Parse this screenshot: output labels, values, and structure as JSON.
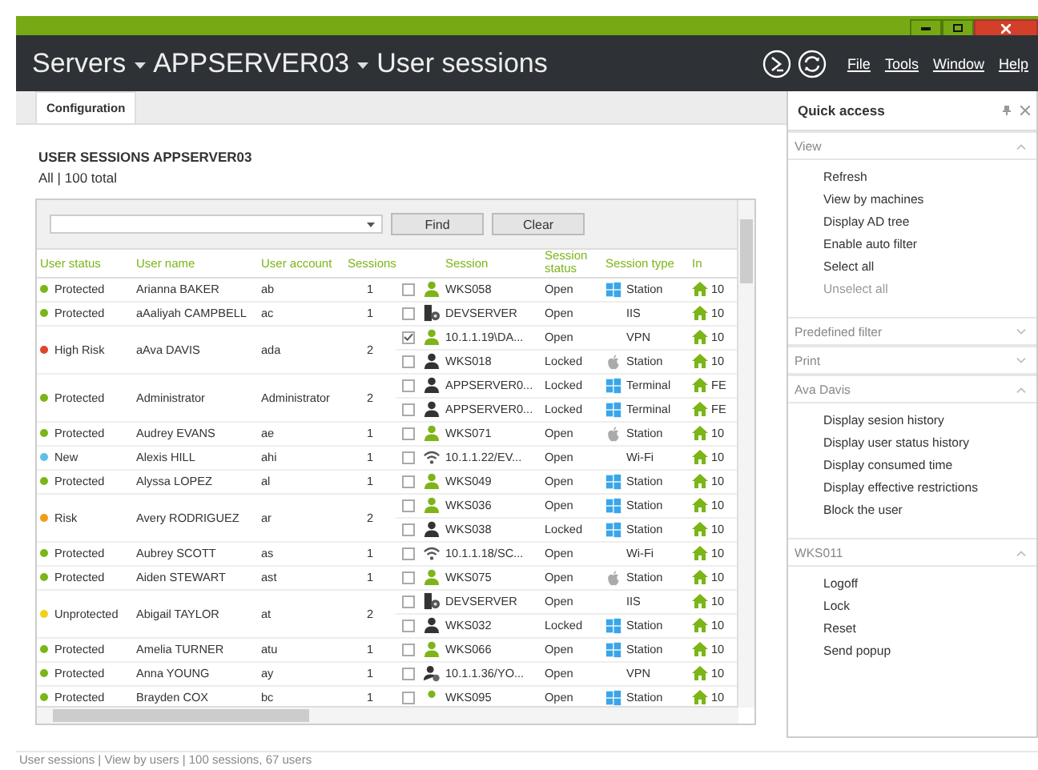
{
  "window": {
    "breadcrumb": [
      "Servers",
      "APPSERVER03",
      "User sessions"
    ],
    "menu": [
      "File",
      "Tools",
      "Window",
      "Help"
    ]
  },
  "tabs": [
    {
      "label": "Configuration",
      "selected": true
    }
  ],
  "heading": "USER SESSIONS APPSERVER03",
  "subheading": "All | 100 total",
  "filter": {
    "buttons": [
      "Find",
      "Clear"
    ]
  },
  "table": {
    "columns": [
      "User status",
      "User name",
      "User account",
      "Sessions",
      "Session",
      "Session status",
      "Session type",
      "In"
    ],
    "rows": [
      {
        "status": "Protected",
        "color": "#7cb518",
        "name": "Arianna BAKER",
        "account": "ab",
        "count": "1",
        "sessions": [
          {
            "checked": false,
            "kind": "user-open",
            "session": "WKS058",
            "state": "Open",
            "type": {
              "kind": "windows",
              "label": "Station"
            },
            "column_8": "10"
          }
        ]
      },
      {
        "status": "Protected",
        "color": "#7cb518",
        "name": "aAaliyah CAMPBELL",
        "account": "ac",
        "count": "1",
        "sessions": [
          {
            "checked": false,
            "kind": "server",
            "session": "DEVSERVER",
            "state": "Open",
            "type": {
              "kind": "plain",
              "label": "IIS"
            },
            "column_8": "10"
          }
        ]
      },
      {
        "status": "High Risk",
        "color": "#e0452b",
        "name": "aAva DAVIS",
        "account": "ada",
        "count": "2",
        "sessions": [
          {
            "checked": true,
            "kind": "user-open",
            "session": "10.1.1.19\\DA...",
            "state": "Open",
            "type": {
              "kind": "plain",
              "label": "VPN"
            },
            "column_8": "10"
          },
          {
            "checked": false,
            "kind": "user-locked",
            "session": "WKS018",
            "state": "Locked",
            "type": {
              "kind": "apple",
              "label": "Station"
            },
            "column_8": "10"
          }
        ]
      },
      {
        "status": "Protected",
        "color": "#7cb518",
        "name": "Administrator",
        "account": "Administrator",
        "count": "2",
        "sessions": [
          {
            "checked": false,
            "kind": "user-locked",
            "session": "APPSERVER0...",
            "state": "Locked",
            "type": {
              "kind": "windows",
              "label": "Terminal"
            },
            "column_8": "FE"
          },
          {
            "checked": false,
            "kind": "user-locked",
            "session": "APPSERVER0...",
            "state": "Locked",
            "type": {
              "kind": "windows",
              "label": "Terminal"
            },
            "column_8": "FE"
          }
        ]
      },
      {
        "status": "Protected",
        "color": "#7cb518",
        "name": "Audrey EVANS",
        "account": "ae",
        "count": "1",
        "sessions": [
          {
            "checked": false,
            "kind": "user-open",
            "session": "WKS071",
            "state": "Open",
            "type": {
              "kind": "apple",
              "label": "Station"
            },
            "column_8": "10"
          }
        ]
      },
      {
        "status": "New",
        "color": "#5bc0e8",
        "name": "Alexis HILL",
        "account": "ahi",
        "count": "1",
        "sessions": [
          {
            "checked": false,
            "kind": "wifi",
            "session": "10.1.1.22/EV...",
            "state": "Open",
            "type": {
              "kind": "plain",
              "label": "Wi-Fi"
            },
            "column_8": "10"
          }
        ]
      },
      {
        "status": "Protected",
        "color": "#7cb518",
        "name": "Alyssa LOPEZ",
        "account": "al",
        "count": "1",
        "sessions": [
          {
            "checked": false,
            "kind": "user-open",
            "session": "WKS049",
            "state": "Open",
            "type": {
              "kind": "windows",
              "label": "Station"
            },
            "column_8": "10"
          }
        ]
      },
      {
        "status": "Risk",
        "color": "#f39c12",
        "name": "Avery RODRIGUEZ",
        "account": "ar",
        "count": "2",
        "sessions": [
          {
            "checked": false,
            "kind": "user-open",
            "session": "WKS036",
            "state": "Open",
            "type": {
              "kind": "windows",
              "label": "Station"
            },
            "column_8": "10"
          },
          {
            "checked": false,
            "kind": "user-locked",
            "session": "WKS038",
            "state": "Locked",
            "type": {
              "kind": "windows",
              "label": "Station"
            },
            "column_8": "10"
          }
        ]
      },
      {
        "status": "Protected",
        "color": "#7cb518",
        "name": "Aubrey SCOTT",
        "account": "as",
        "count": "1",
        "sessions": [
          {
            "checked": false,
            "kind": "wifi",
            "session": "10.1.1.18/SC...",
            "state": "Open",
            "type": {
              "kind": "plain",
              "label": "Wi-Fi"
            },
            "column_8": "10"
          }
        ]
      },
      {
        "status": "Protected",
        "color": "#7cb518",
        "name": "Aiden STEWART",
        "account": "ast",
        "count": "1",
        "sessions": [
          {
            "checked": false,
            "kind": "user-open",
            "session": "WKS075",
            "state": "Open",
            "type": {
              "kind": "apple",
              "label": "Station"
            },
            "column_8": "10"
          }
        ]
      },
      {
        "status": "Unprotected",
        "color": "#f1d21b",
        "name": "Abigail TAYLOR",
        "account": "at",
        "count": "2",
        "sessions": [
          {
            "checked": false,
            "kind": "server",
            "session": "DEVSERVER",
            "state": "Open",
            "type": {
              "kind": "plain",
              "label": "IIS"
            },
            "column_8": "10"
          },
          {
            "checked": false,
            "kind": "user-locked",
            "session": "WKS032",
            "state": "Locked",
            "type": {
              "kind": "windows",
              "label": "Station"
            },
            "column_8": "10"
          }
        ]
      },
      {
        "status": "Protected",
        "color": "#7cb518",
        "name": "Amelia TURNER",
        "account": "atu",
        "count": "1",
        "sessions": [
          {
            "checked": false,
            "kind": "user-open",
            "session": "WKS066",
            "state": "Open",
            "type": {
              "kind": "windows",
              "label": "Station"
            },
            "column_8": "10"
          }
        ]
      },
      {
        "status": "Protected",
        "color": "#7cb518",
        "name": "Anna YOUNG",
        "account": "ay",
        "count": "1",
        "sessions": [
          {
            "checked": false,
            "kind": "vpn-user",
            "session": "10.1.1.36/YO...",
            "state": "Open",
            "type": {
              "kind": "plain",
              "label": "VPN"
            },
            "column_8": "10"
          }
        ]
      },
      {
        "status": "Protected",
        "color": "#7cb518",
        "name": "Brayden COX",
        "account": "bc",
        "count": "1",
        "sessions": [
          {
            "checked": false,
            "kind": "dot",
            "session": "WKS095",
            "state": "Open",
            "type": {
              "kind": "windows",
              "label": "Station"
            },
            "column_8": "10"
          }
        ]
      }
    ]
  },
  "quick_access": {
    "title": "Quick access",
    "sections": [
      {
        "title": "View",
        "expanded": true,
        "items": [
          {
            "label": "Refresh",
            "disabled": false
          },
          {
            "label": "View by machines",
            "disabled": false
          },
          {
            "label": "Display AD tree",
            "disabled": false
          },
          {
            "label": "Enable auto filter",
            "disabled": false
          },
          {
            "label": "Select all",
            "disabled": false
          },
          {
            "label": "Unselect all",
            "disabled": true
          }
        ]
      },
      {
        "title": "Predefined filter",
        "expanded": false
      },
      {
        "title": "Print",
        "expanded": false
      },
      {
        "title": "Ava Davis",
        "expanded": true,
        "items": [
          {
            "label": "Display sesion history",
            "disabled": false
          },
          {
            "label": "Display user status history",
            "disabled": false
          },
          {
            "label": "Display consumed time",
            "disabled": false
          },
          {
            "label": "Display effective restrictions",
            "disabled": false
          },
          {
            "label": "Block the user",
            "disabled": false
          }
        ]
      },
      {
        "title": "WKS011",
        "expanded": true,
        "items": [
          {
            "label": "Logoff",
            "disabled": false
          },
          {
            "label": "Lock",
            "disabled": false
          },
          {
            "label": "Reset",
            "disabled": false
          },
          {
            "label": "Send popup",
            "disabled": false
          }
        ]
      }
    ]
  },
  "status_bar": "User sessions  |  View by users  |  100 sessions, 67 users"
}
